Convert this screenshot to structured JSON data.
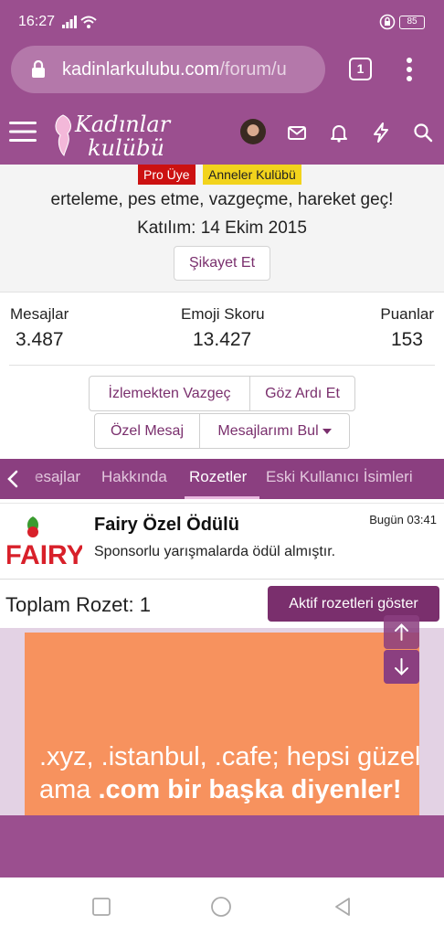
{
  "status_bar": {
    "time": "16:27",
    "battery": "85"
  },
  "browser": {
    "url_main": "kadinlarkulubu.com",
    "url_rest": "/forum/u",
    "tab_count": "1"
  },
  "site": {
    "logo_line1": "Kadınlar",
    "logo_line2": "kulübü"
  },
  "profile": {
    "badges": [
      "Pro Üye",
      "Anneler Kulübü"
    ],
    "tagline": "erteleme, pes etme, vazgeçme, hareket geç!",
    "joined": "Katılım: 14 Ekim 2015",
    "report_label": "Şikayet Et",
    "stats": [
      {
        "label": "Mesajlar",
        "value": "3.487"
      },
      {
        "label": "Emoji Skoru",
        "value": "13.427"
      },
      {
        "label": "Puanlar",
        "value": "153"
      }
    ],
    "actions": {
      "unfollow": "İzlemekten Vazgeç",
      "ignore": "Göz Ardı Et",
      "private_message": "Özel Mesaj",
      "find_messages": "Mesajlarımı Bul"
    }
  },
  "tabs": [
    "esajlar",
    "Hakkında",
    "Rozetler",
    "Eski Kullanıcı İsimleri"
  ],
  "active_tab": "Rozetler",
  "award": {
    "logo_text": "FAIRY",
    "title": "Fairy Özel Ödülü",
    "description": "Sponsorlu yarışmalarda ödül almıştır.",
    "date": "Bugün 03:41"
  },
  "badges_summary": {
    "total": "Toplam Rozet: 1",
    "show_active_label": "Aktif rozetleri göster"
  },
  "ad": {
    "line1": ".xyz, .istanbul, .cafe; hepsi güzel",
    "line2_prefix": "ama ",
    "line2_bold": ".com bir başka diyenler!"
  },
  "colors": {
    "brand": "#9b4f8f",
    "tab_bar": "#8b3f80",
    "button_dark": "#7a2f6d",
    "pro_badge": "#cc1111",
    "anneler_badge": "#f2d31c",
    "ad_bg": "#f7925e"
  }
}
